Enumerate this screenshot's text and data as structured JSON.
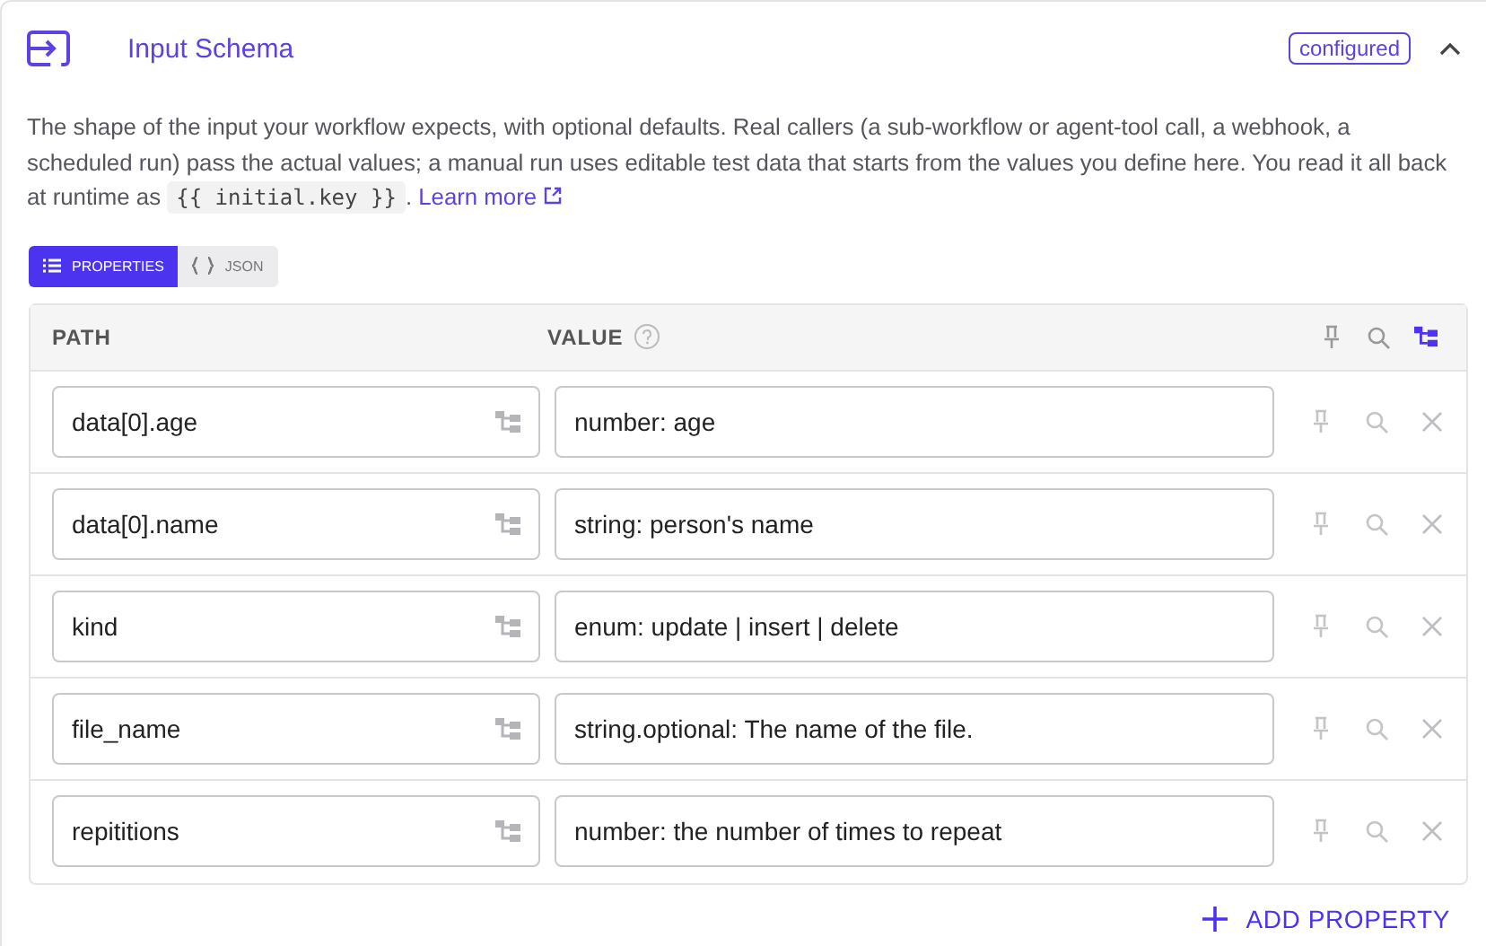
{
  "section": {
    "title": "Input Schema",
    "badge": "configured",
    "expanded": true
  },
  "description": {
    "text": "The shape of the input your workflow expects, with optional defaults. Real callers (a sub-workflow or agent-tool call, a webhook, a scheduled run) pass the actual values; a manual run uses editable test data that starts from the values you define here. You read it all back at runtime as",
    "code": "{{ initial.key }}",
    "after": ".",
    "link": "Learn more"
  },
  "tabs": [
    {
      "label": "PROPERTIES",
      "kind": "list",
      "selected": true
    },
    {
      "label": "JSON",
      "kind": "braces",
      "selected": false
    }
  ],
  "table": {
    "columns": [
      "PATH",
      "VALUE"
    ],
    "tree_view_on": true,
    "rows": [
      {
        "path": "data[0].age",
        "value": "number: age"
      },
      {
        "path": "data[0].name",
        "value": "string: person's name"
      },
      {
        "path": "kind",
        "value": "enum: update | insert | delete"
      },
      {
        "path": "file_name",
        "value": "string.optional: The name of the file."
      },
      {
        "path": "repititions",
        "value": "number: the number of times to repeat"
      }
    ]
  },
  "add_button": "ADD PROPERTY"
}
